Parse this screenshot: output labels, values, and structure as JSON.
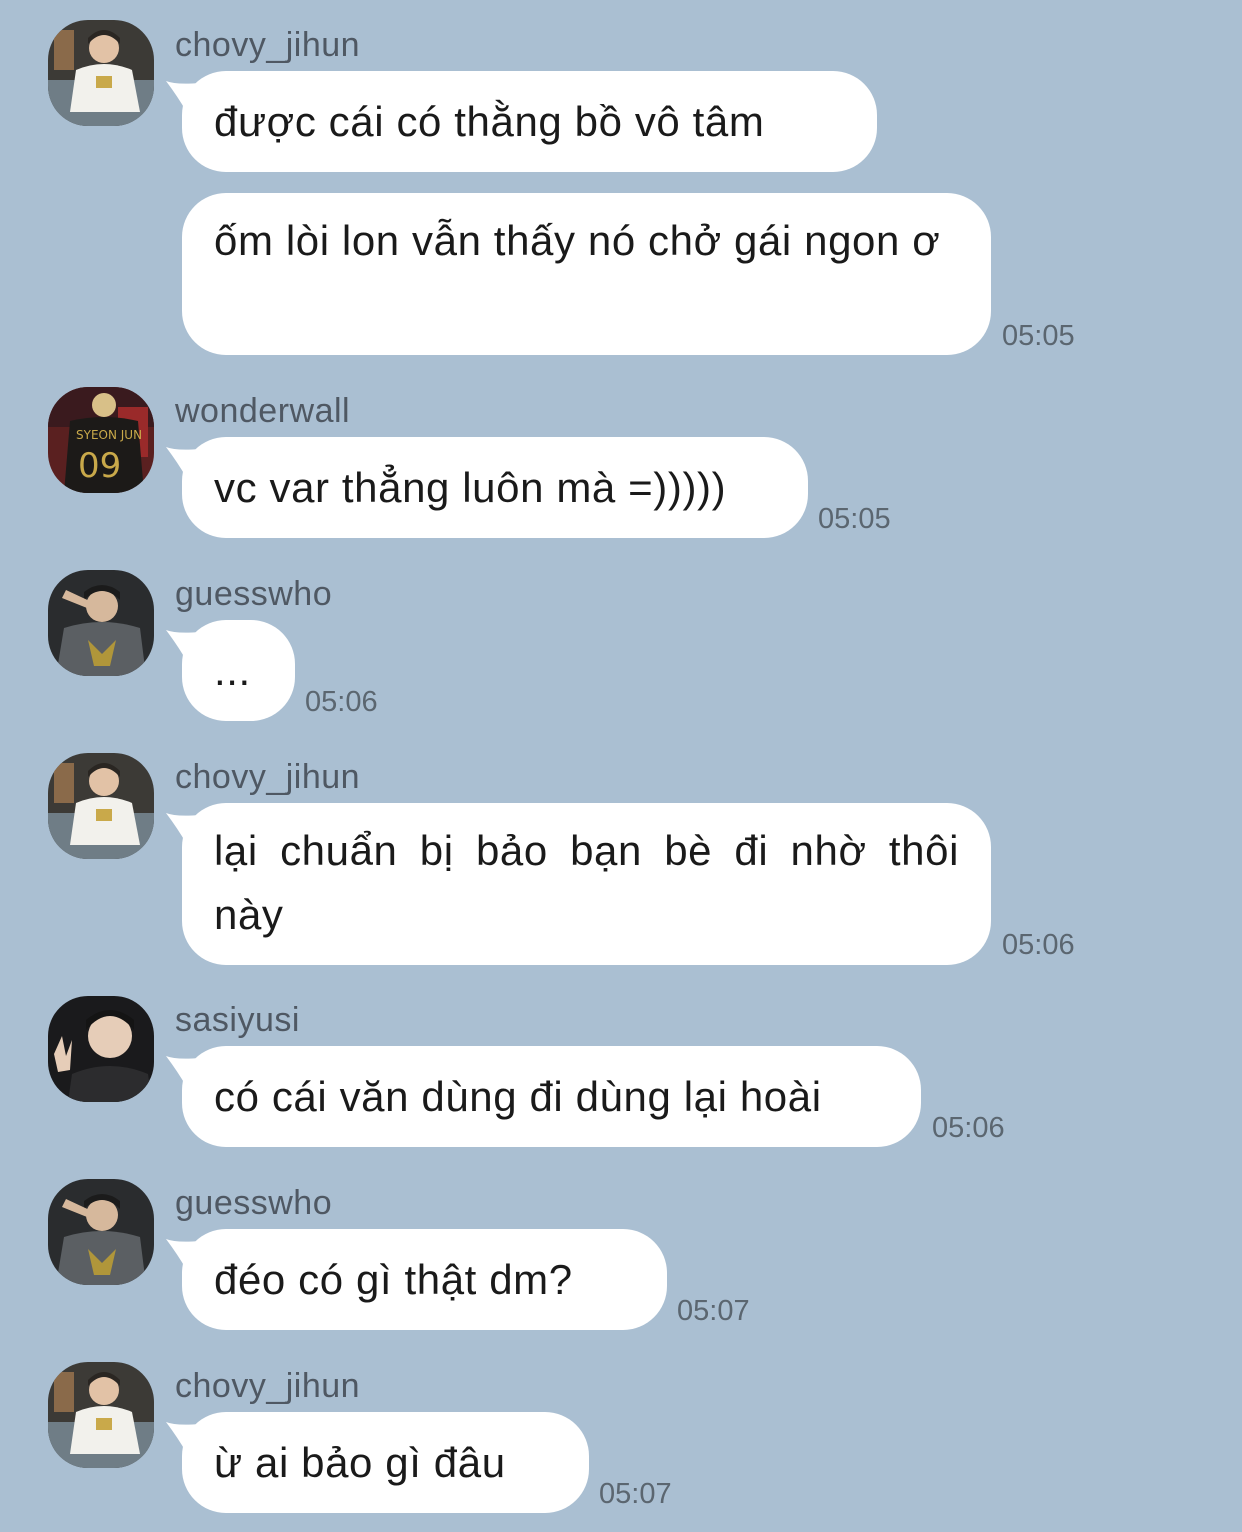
{
  "messages": [
    {
      "sender": "chovy_jihun",
      "avatar_icon": "chovy-avatar",
      "bubbles": [
        "được cái có thằng bồ vô tâm",
        "ốm lòi lon vẫn thấy nó chở gái ngon ơ"
      ],
      "time": "05:05"
    },
    {
      "sender": "wonderwall",
      "avatar_icon": "wonderwall-avatar",
      "bubbles": [
        "vc var thẳng luôn mà =)))))"
      ],
      "time": "05:05"
    },
    {
      "sender": "guesswho",
      "avatar_icon": "guesswho-avatar",
      "bubbles": [
        "..."
      ],
      "time": "05:06"
    },
    {
      "sender": "chovy_jihun",
      "avatar_icon": "chovy-avatar",
      "bubbles": [
        "lại chuẩn bị bảo bạn bè đi nhờ thôi này"
      ],
      "time": "05:06"
    },
    {
      "sender": "sasiyusi",
      "avatar_icon": "sasiyusi-avatar",
      "bubbles": [
        "có cái văn dùng đi dùng lại hoài"
      ],
      "time": "05:06"
    },
    {
      "sender": "guesswho",
      "avatar_icon": "guesswho-avatar",
      "bubbles": [
        "đéo có gì thật dm?"
      ],
      "time": "05:07"
    },
    {
      "sender": "chovy_jihun",
      "avatar_icon": "chovy-avatar",
      "bubbles": [
        "ừ ai bảo gì đâu"
      ],
      "time": "05:07"
    }
  ],
  "colors": {
    "background": "#aabfd2",
    "bubble": "#ffffff",
    "sender_text": "#4f5863",
    "time_text": "#5b6670"
  }
}
